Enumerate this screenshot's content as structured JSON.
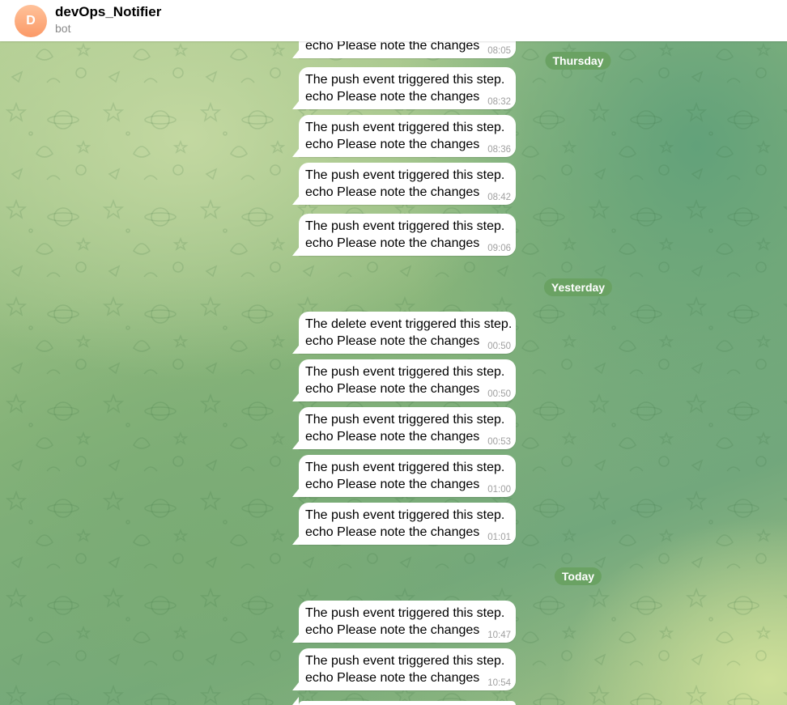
{
  "chat": {
    "name": "devOps_Notifier",
    "status": "bot",
    "avatar_letter": "D"
  },
  "date_separators": [
    "Thursday",
    "Yesterday",
    "Today"
  ],
  "messages": [
    {
      "line1": "",
      "line2": "echo Please note the changes",
      "time": "08:05"
    },
    {
      "line1": "The push event triggered this step.",
      "line2": "echo Please note the changes",
      "time": "08:32"
    },
    {
      "line1": "The push event triggered this step.",
      "line2": "echo Please note the changes",
      "time": "08:36"
    },
    {
      "line1": "The push event triggered this step.",
      "line2": "echo Please note the changes",
      "time": "08:42"
    },
    {
      "line1": "The push event triggered this step.",
      "line2": "echo Please note the changes",
      "time": "09:06"
    },
    {
      "line1": "The delete event triggered this step.",
      "line2": "echo Please note the changes",
      "time": "00:50"
    },
    {
      "line1": "The push event triggered this step.",
      "line2": "echo Please note the changes",
      "time": "00:50"
    },
    {
      "line1": "The push event triggered this step.",
      "line2": "echo Please note the changes",
      "time": "00:53"
    },
    {
      "line1": "The push event triggered this step.",
      "line2": "echo Please note the changes",
      "time": "01:00"
    },
    {
      "line1": "The push event triggered this step.",
      "line2": "echo Please note the changes",
      "time": "01:01"
    },
    {
      "line1": "The push event triggered this step.",
      "line2": "echo Please note the changes",
      "time": "10:47"
    },
    {
      "line1": "The push event triggered this step.",
      "line2": "echo Please note the changes",
      "time": "10:54"
    }
  ],
  "colors": {
    "header_bg": "#ffffff",
    "avatar_gradient": [
      "#ffc29a",
      "#fb9a67"
    ],
    "bubble_bg": "#ffffff",
    "separator_bg": "#6aa263",
    "time_text": "#a0a0a0"
  }
}
